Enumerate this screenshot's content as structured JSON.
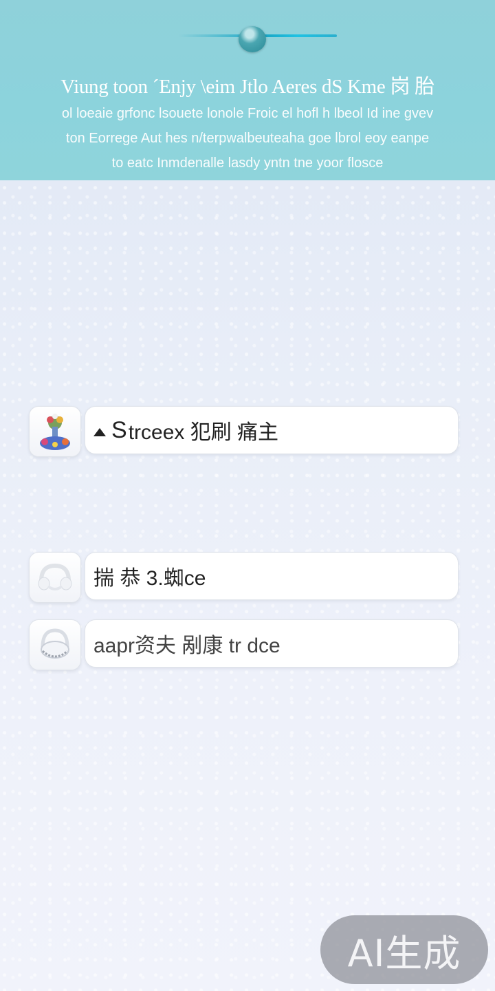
{
  "header": {
    "title": "Viung toon  ´Enjy \\eim Jtlo Aeres dS Kme 岗 胎",
    "lines": [
      "ol loeaie grfonc lsouete lonole Froic el hofl h lbeol Id ine gvev",
      "ton Eorrege Aut hes  n/terpwalbeuteaha  goe lbrol eoy eanpe",
      "to eatc Inmdenalle  lasdy yntn tne yoor flosce"
    ]
  },
  "rows": [
    {
      "icon": "bouquet-icon",
      "text_prefix": "S",
      "text": " trceex 犯刷 痛主"
    },
    {
      "icon": "headphones-icon",
      "text_prefix": "",
      "text": "揣 恭 3.蜘ce"
    },
    {
      "icon": "headset-icon",
      "text_prefix": "",
      "text": "aapr资夫 剐康  tr  dce"
    }
  ],
  "badge": {
    "label": "AI生成"
  },
  "colors": {
    "header_bg": "#8fd1da",
    "page_bg": "#e9eef8",
    "accent": "#1aa7c6"
  }
}
